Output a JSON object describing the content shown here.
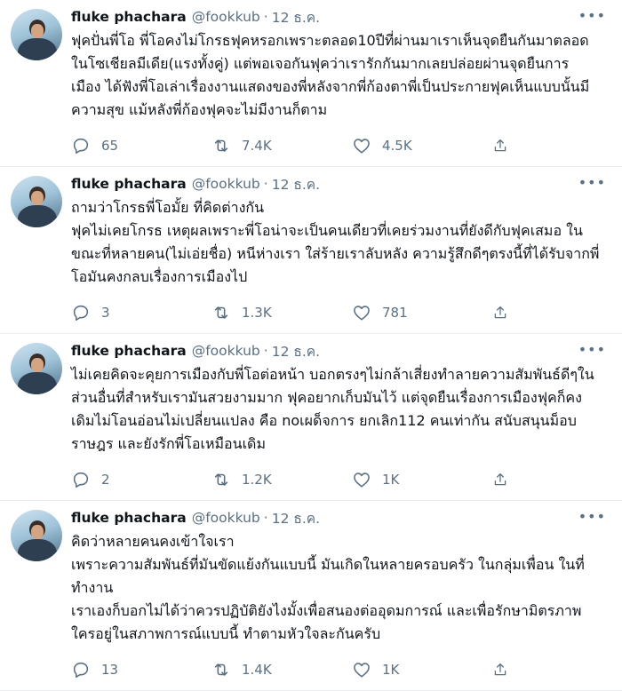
{
  "tweets": [
    {
      "name": "fluke phachara",
      "handle": "@fookkub",
      "dot": "·",
      "date": "12 ธ.ค.",
      "more": "•••",
      "lines": [
        "ฟุคปั่นพี่โอ พี่โอคงไม่โกรธฟุคหรอกเพราะตลอด10ปีที่ผ่านมาเราเห็นจุดยืนกันมาตลอด",
        "ในโซเชียลมีเดีย(แรงทั้งคู่) แต่พอเจอกันฟุคว่าเรารักกันมากเลยปล่อยผ่านจุดยืนการ",
        "เมือง ได้ฟังพี่โอเล่าเรื่องงานแสดงของพี่หลังจากพี่ก้องตาพี่เป็นประกายฟุคเห็นแบบนั้นมี",
        "ความสุข แม้หลังพี่ก้องฟุคจะไม่มีงานก็ตาม"
      ],
      "replies": "65",
      "retweets": "7.4K",
      "likes": "4.5K"
    },
    {
      "name": "fluke phachara",
      "handle": "@fookkub",
      "dot": "·",
      "date": "12 ธ.ค.",
      "more": "•••",
      "lines": [
        "ถามว่าโกรธพี่โอมั้ย ที่คิดต่างกัน",
        "ฟุคไม่เคยโกรธ เหตุผลเพราะพี่โอน่าจะเป็นคนเดียวที่เคยร่วมงานที่ยังดีกับฟุคเสมอ ใน",
        "ขณะที่หลายคน(ไม่เอ่ยชื่อ) หนีห่างเรา ใส่ร้ายเราลับหลัง ความรู้สึกดีๆตรงนี้ที่ได้รับจากพี่",
        "โอมันคงกลบเรื่องการเมืองไป"
      ],
      "replies": "3",
      "retweets": "1.3K",
      "likes": "781"
    },
    {
      "name": "fluke phachara",
      "handle": "@fookkub",
      "dot": "·",
      "date": "12 ธ.ค.",
      "more": "•••",
      "lines": [
        "ไม่เคยคิดจะคุยการเมืองกับพี่โอต่อหน้า บอกตรงๆไม่กล้าเสี่ยงทำลายความสัมพันธ์ดีๆใน",
        "ส่วนอื่นที่สำหรับเรามันสวยงามมาก ฟุคอยากเก็บมันไว้ แต่จุดยืนเรื่องการเมืองฟุคก็คง",
        "เดิมไม่โอนอ่อนไม่เปลี่ยนแปลง คือ noเผด็จการ ยกเลิก112 คนเท่ากัน สนับสนุนม็อบ",
        "ราษฎร และยังรักพี่โอเหมือนเดิม"
      ],
      "replies": "2",
      "retweets": "1.2K",
      "likes": "1K"
    },
    {
      "name": "fluke phachara",
      "handle": "@fookkub",
      "dot": "·",
      "date": "12 ธ.ค.",
      "more": "•••",
      "lines": [
        "คิดว่าหลายคนคงเข้าใจเรา",
        "เพราะความสัมพันธ์ที่มันขัดแย้งกันแบบนี้ มันเกิดในหลายครอบครัว ในกลุ่มเพื่อน ในที่",
        "ทำงาน",
        "เราเองก็บอกไม่ได้ว่าควรปฏิบัติยังไงมั้งเพื่อสนองต่ออุดมการณ์ และเพื่อรักษามิตรภาพ",
        "ใครอยู่ในสภาพการณ์แบบนี้ ทำตามหัวใจละกันครับ"
      ],
      "replies": "13",
      "retweets": "1.4K",
      "likes": "1K"
    }
  ],
  "icons": {
    "reply": "reply-icon",
    "retweet": "retweet-icon",
    "like": "heart-icon",
    "share": "share-icon"
  },
  "colors": {
    "text": "#0f1419",
    "secondary": "#5b7083",
    "divider": "#ebeef0"
  }
}
